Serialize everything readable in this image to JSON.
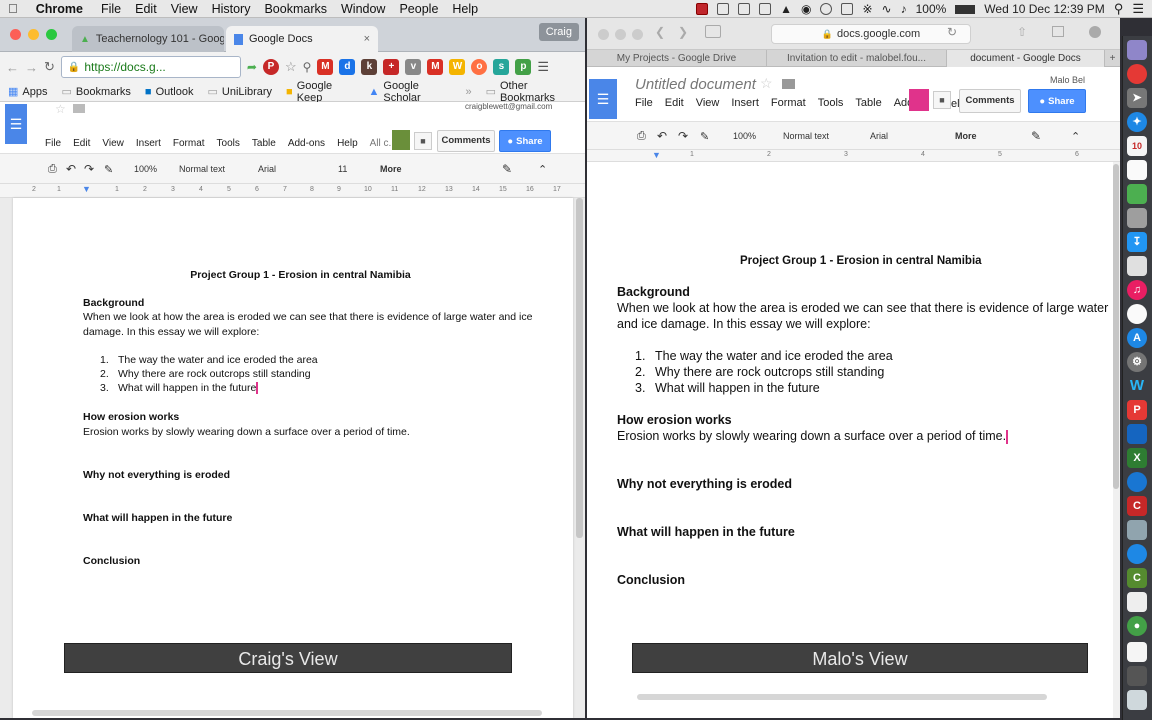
{
  "menubar": {
    "app": "Chrome",
    "items": [
      "File",
      "Edit",
      "View",
      "History",
      "Bookmarks",
      "Window",
      "People",
      "Help"
    ],
    "battery": "100%",
    "clock": "Wed 10 Dec  12:39 PM"
  },
  "left": {
    "tabs": [
      "Teachernology 101 - Goog",
      "Google Docs"
    ],
    "user_badge": "Craig",
    "url": "https://docs.g...",
    "bookmarks": [
      "Apps",
      "Bookmarks",
      "Outlook",
      "UniLibrary",
      "Google Keep",
      "Google Scholar",
      "Other Bookmarks"
    ],
    "account": "craigblewett@gmail.com",
    "doc_menu": [
      "File",
      "Edit",
      "View",
      "Insert",
      "Format",
      "Tools",
      "Table",
      "Add-ons",
      "Help",
      "All c..."
    ],
    "comments": "Comments",
    "share": "Share",
    "toolbar": {
      "zoom": "100%",
      "style": "Normal text",
      "font": "Arial",
      "size": "11",
      "more": "More"
    },
    "ruler": [
      "2",
      "1",
      "1",
      "2",
      "3",
      "4",
      "5",
      "6",
      "7",
      "8",
      "9",
      "10",
      "11",
      "12",
      "13",
      "14",
      "15",
      "16",
      "17"
    ],
    "caption": "Craig's View"
  },
  "right": {
    "url": "docs.google.com",
    "tabs": [
      "My Projects - Google Drive",
      "Invitation to edit - malobel.fou...",
      "document - Google Docs"
    ],
    "doc_title": "Untitled document",
    "account": "Malo Bel",
    "doc_menu": [
      "File",
      "Edit",
      "View",
      "Insert",
      "Format",
      "Tools",
      "Table",
      "Add"
    ],
    "help_partial": "elp",
    "comments": "Comments",
    "share": "Share",
    "toolbar": {
      "zoom": "100%",
      "style": "Normal text",
      "font": "Arial",
      "more": "More"
    },
    "ruler": [
      "1",
      "2",
      "3",
      "4",
      "5",
      "6"
    ],
    "caption": "Malo's View"
  },
  "document": {
    "title": "Project Group 1 - Erosion in central Namibia",
    "background_heading": "Background",
    "background_text": "When we look at how the area is eroded we can see that there is evidence of large water and ice damage. In this essay we will explore:",
    "list": [
      {
        "num": "1.",
        "text": "The way the water and ice eroded the area"
      },
      {
        "num": "2.",
        "text": "Why there are rock outcrops still standing"
      },
      {
        "num": "3.",
        "text": "What will happen in the future"
      }
    ],
    "erosion_heading": "How erosion works",
    "erosion_text": "Erosion works by slowly wearing down a surface over a period of time.",
    "why_heading": "Why not everything is eroded",
    "future_heading": "What will happen in the future",
    "conclusion_heading": "Conclusion"
  },
  "icons": [
    "apple-icon",
    "search-icon",
    "wifi-icon",
    "bluetooth-icon",
    "battery-icon",
    "notification-icon",
    "docs-icon",
    "folder-icon",
    "star-icon",
    "print-icon",
    "undo-icon",
    "redo-icon",
    "paint-format-icon",
    "pencil-icon",
    "collapse-icon",
    "back-icon",
    "forward-icon",
    "reload-icon",
    "lock-icon",
    "share-icon",
    "trash-icon"
  ]
}
